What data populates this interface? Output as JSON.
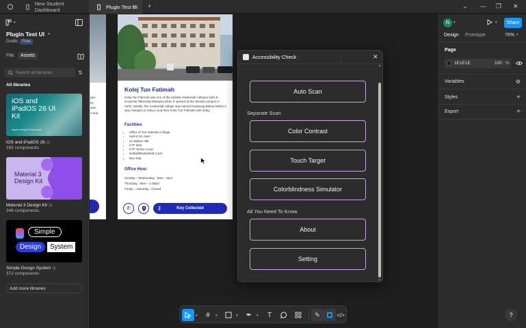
{
  "tabs": [
    {
      "label": "New Student Dashboard"
    },
    {
      "label": "Plugin Test UI"
    }
  ],
  "left_panel": {
    "file_name": "Plugin Test UI",
    "drafts": "Drafts",
    "plan_badge": "Free",
    "tab_file": "File",
    "tab_assets": "Assets",
    "search_placeholder": "Search all libraries",
    "all_libraries": "All libraries",
    "libraries": [
      {
        "name": "iOS and iPadOS 26",
        "count": "165 components",
        "cover_title": "iOS and iPadOS 26 UI Kit",
        "cover_footer": "Apple Design Resources"
      },
      {
        "name": "Material 3 Design Kit",
        "count": "346 components",
        "cover_title": "Material 3 Design Kit"
      },
      {
        "name": "Simple Design System",
        "count": "372 components",
        "cover_words": [
          "Simple",
          "Design",
          "System"
        ]
      }
    ],
    "add_more": "Add more libraries"
  },
  "frame_left": {
    "lines": [
      "ges",
      "by",
      "was",
      "2 and"
    ],
    "button_glyph": ""
  },
  "frame_main": {
    "title": "Kolej Tun Fatimah",
    "description": "Kolej Tun Fatimah was one of the earliest residential colleges built at Universiti Teknologi Malaysia when it opened at the Skudai campus in 1978. Initially, this residential college was named Kampung Bellan before it was changed to Kolej 2 and then Kolej Tun Fatimah until today.",
    "facilities_heading": "Facilities",
    "facilities": [
      "Office of Tun Fatimah College",
      "Hall of Sri Alam",
      "Sri Bellan Hall",
      "KTF field",
      "KTF Tennis Court",
      "Netball/Basketball Court",
      "Bus stop"
    ],
    "office_heading": "Office Hour",
    "office_hours": [
      "Sunday – Wednesday : 8am – 5pm",
      "Thursday : 8am – 3.30pm",
      "Friday – Saturday : Closed"
    ],
    "key_button": "Key Collected"
  },
  "plugin": {
    "title": "Accessibility Check",
    "auto_scan": "Auto Scan",
    "separate_scan_label": "Separate Scan",
    "buttons": [
      "Color Contrast",
      "Touch Target",
      "Colorblindness Simulator"
    ],
    "know_label": "All You Need To Know",
    "about": "About",
    "setting": "Setting"
  },
  "right_panel": {
    "avatar_letter": "N",
    "share": "Share",
    "tab_design": "Design",
    "tab_prototype": "Prototype",
    "zoom": "76%",
    "page_heading": "Page",
    "page_color": "1E1E1E",
    "page_opacity": "100",
    "page_opacity_unit": "%",
    "variables": "Variables",
    "styles": "Styles",
    "export": "Export"
  },
  "help": "?",
  "colors": {
    "accent": "#0d99ff",
    "frame_blue": "#1f2bb8",
    "plugin_border": "#c8a6e6"
  }
}
